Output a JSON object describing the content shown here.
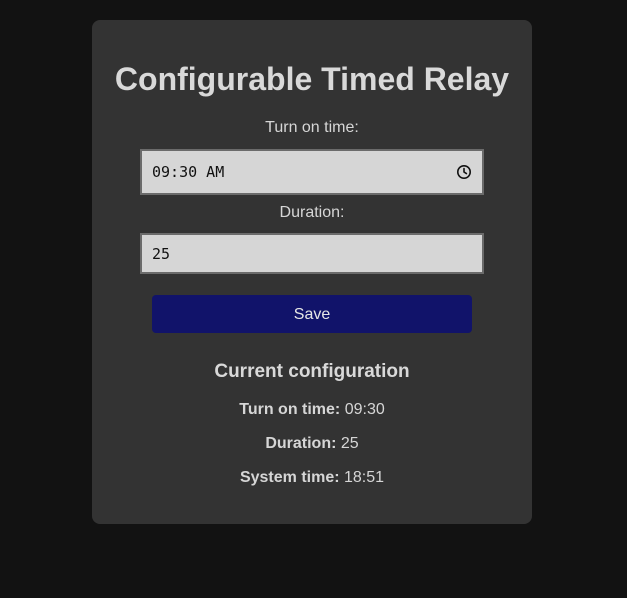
{
  "app": {
    "title": "Configurable Timed Relay"
  },
  "form": {
    "turn_on_label": "Turn on time:",
    "turn_on_value": "09:30 AM",
    "duration_label": "Duration:",
    "duration_value": "25",
    "save_label": "Save",
    "clock_icon": "clock-icon"
  },
  "current": {
    "heading": "Current configuration",
    "turn_on_key": "Turn on time:",
    "turn_on_val": "09:30",
    "duration_key": "Duration:",
    "duration_val": "25",
    "system_time_key": "System time:",
    "system_time_val": "18:51"
  },
  "colors": {
    "background": "#121212",
    "card": "#333333",
    "input": "#d6d6d6",
    "button": "#11136a"
  }
}
